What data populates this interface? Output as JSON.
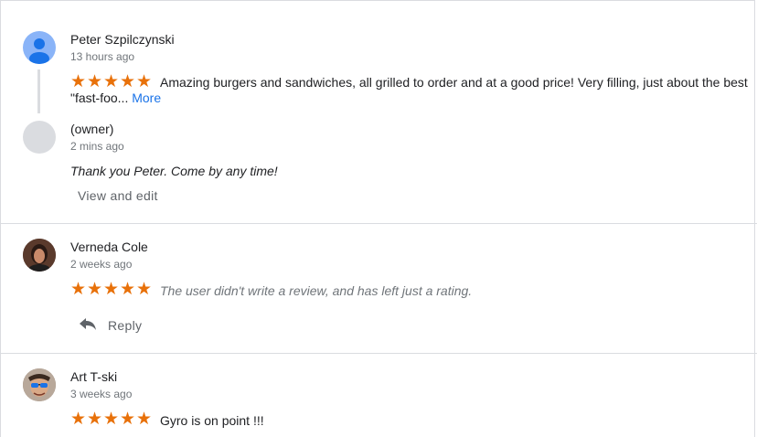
{
  "reviews": [
    {
      "author": "Peter Szpilczynski",
      "time": "13 hours ago",
      "rating": 5,
      "text": "Amazing burgers and sandwiches, all grilled to order and at a good price! Very filling, just about the best \"fast-foo...",
      "more_label": "More",
      "avatar": "default-person-icon",
      "owner_reply": {
        "name": "(owner)",
        "time": "2 mins ago",
        "text": "Thank you Peter. Come by any time!",
        "action_label": "View and edit"
      }
    },
    {
      "author": "Verneda Cole",
      "time": "2 weeks ago",
      "rating": 5,
      "text": "The user didn't write a review, and has left just a rating.",
      "reply_label": "Reply",
      "avatar": "profile-photo"
    },
    {
      "author": "Art T-ski",
      "time": "3 weeks ago",
      "rating": 5,
      "text": "Gyro is on point !!!",
      "avatar": "profile-photo"
    }
  ],
  "colors": {
    "star": "#e8710a",
    "link": "#1a73e8",
    "secondary_text": "#70757a",
    "divider": "#dadce0"
  }
}
